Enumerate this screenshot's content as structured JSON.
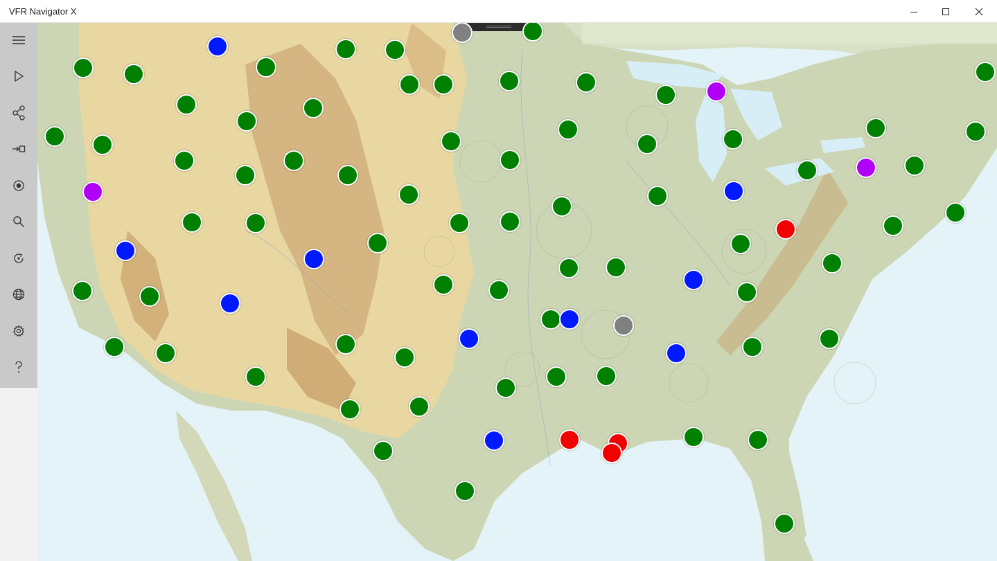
{
  "window": {
    "title": "VFR Navigator X",
    "controls": [
      "minimize-icon",
      "maximize-icon",
      "close-icon"
    ]
  },
  "sidebar": {
    "items": [
      {
        "name": "menu",
        "icon": "hamburger-menu-icon"
      },
      {
        "name": "play",
        "icon": "play-icon"
      },
      {
        "name": "route",
        "icon": "route-share-icon"
      },
      {
        "name": "goto",
        "icon": "direct-to-icon"
      },
      {
        "name": "position",
        "icon": "position-target-icon"
      },
      {
        "name": "search",
        "icon": "search-icon"
      },
      {
        "name": "refresh",
        "icon": "refresh-icon"
      },
      {
        "name": "map-layers",
        "icon": "globe-icon"
      },
      {
        "name": "settings",
        "icon": "gear-icon"
      },
      {
        "name": "help",
        "icon": "help-icon"
      }
    ]
  },
  "map": {
    "colors": {
      "vfr": "#008000",
      "mvfr": "#0019ff",
      "ifr": "#f20000",
      "lifr": "#b000f5",
      "unknown": "#808080",
      "water": "#e4f3f7",
      "land": "#d3dcbd",
      "terrain": "#e7cf94"
    },
    "station_counts": {
      "green": 70,
      "blue": 12,
      "red": 4,
      "purple": 3,
      "gray": 2
    }
  }
}
